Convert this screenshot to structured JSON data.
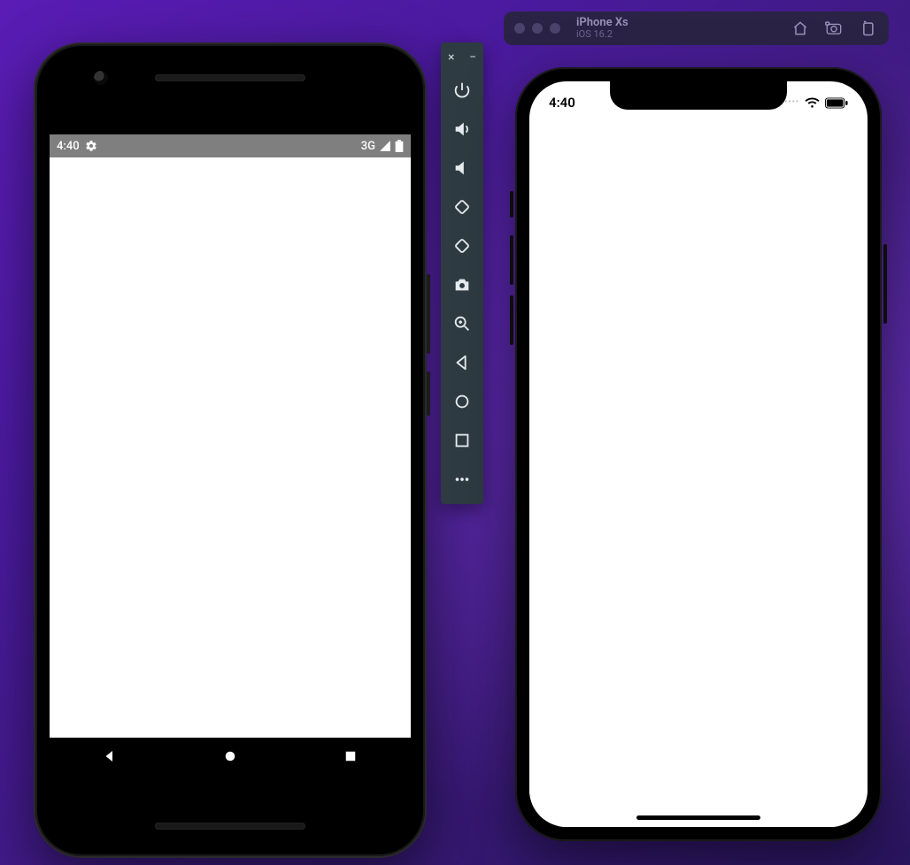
{
  "android": {
    "statusbar": {
      "time": "4:40",
      "network_label": "3G"
    },
    "navbar": {
      "back": "back",
      "home": "home",
      "overview": "overview"
    }
  },
  "emulator_toolbar": {
    "close_label": "×",
    "minimize_label": "−",
    "buttons": [
      "power",
      "volume-up",
      "volume-down",
      "rotate-left",
      "rotate-right",
      "camera",
      "zoom",
      "back",
      "home",
      "overview",
      "more"
    ]
  },
  "ios_window": {
    "device_name": "iPhone Xs",
    "os_version": "iOS 16.2",
    "toolbar_icons": [
      "home",
      "screenshot",
      "rotate"
    ]
  },
  "ios": {
    "statusbar": {
      "time": "4:40"
    }
  }
}
